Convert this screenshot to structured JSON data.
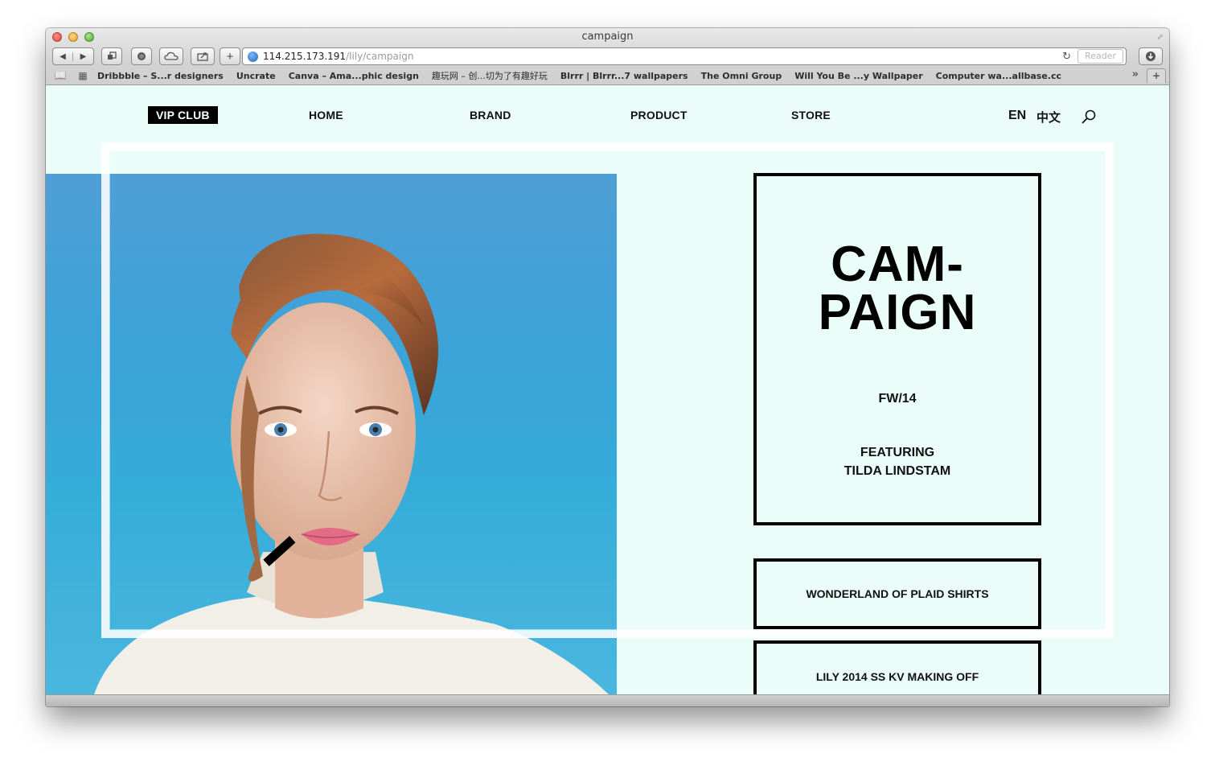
{
  "browser": {
    "window_title": "campaign",
    "url_host": "114.215.173.191",
    "url_path": "/lily/campaign",
    "reader_label": "Reader",
    "bookmarks": [
      "Dribbble – S...r designers",
      "Uncrate",
      "Canva – Ama...phic design",
      "趣玩网 – 创...切为了有趣好玩",
      "Blrrr | Blrrr...7 wallpapers",
      "The Omni Group",
      "Will You Be ...y Wallpaper",
      "Computer wa...allbase.cc"
    ]
  },
  "nav": {
    "vip": "VIP CLUB",
    "home": "HOME",
    "brand": "BRAND",
    "product": "PRODUCT",
    "store": "STORE",
    "lang_en": "EN",
    "lang_zh": "中文"
  },
  "campaign": {
    "title_line1": "CAM-",
    "title_line2": "PAIGN",
    "season": "FW/14",
    "featuring_line1": "FEATURING",
    "featuring_line2": "TILDA LINDSTAM"
  },
  "links": [
    "WONDERLAND OF PLAID SHIRTS",
    "LILY 2014 SS KV MAKING OFF"
  ],
  "colors": {
    "page_background": "#eafdf8",
    "hero_sky": "#3aa3d8",
    "accent": "#000000"
  }
}
